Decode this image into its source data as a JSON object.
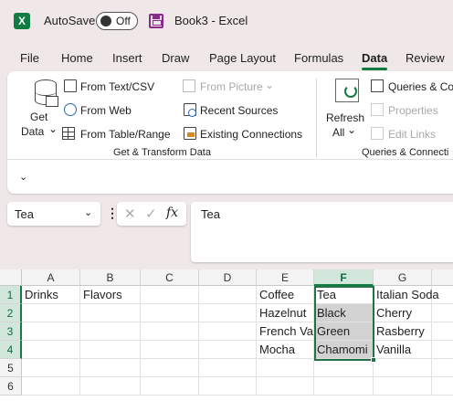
{
  "titlebar": {
    "app_icon": "X",
    "autosave_label": "AutoSave",
    "autosave_state": "Off",
    "doc_title": "Book3  -  Excel"
  },
  "tabs": [
    "File",
    "Home",
    "Insert",
    "Draw",
    "Page Layout",
    "Formulas",
    "Data",
    "Review"
  ],
  "active_tab": "Data",
  "ribbon": {
    "get_data": {
      "line1": "Get",
      "line2": "Data",
      "chev": "⌄"
    },
    "from_text_csv": "From Text/CSV",
    "from_web": "From Web",
    "from_table_range": "From Table/Range",
    "from_picture": "From Picture",
    "from_picture_chev": "⌄",
    "recent_sources": "Recent Sources",
    "existing_connections": "Existing Connections",
    "group_get_transform": "Get & Transform Data",
    "refresh_all": {
      "line1": "Refresh",
      "line2": "All",
      "chev": "⌄"
    },
    "queries_connections": "Queries & Co",
    "properties": "Properties",
    "edit_links": "Edit Links",
    "group_queries": "Queries & Connecti",
    "expand_glyph": "⌄"
  },
  "formula": {
    "name_box": "Tea",
    "name_box_chev": "⌄",
    "dots": "⋮",
    "cancel_glyph": "✕",
    "enter_glyph": "✓",
    "fx_label": "fx",
    "value": "Tea"
  },
  "sheet": {
    "columns": [
      "A",
      "B",
      "C",
      "D",
      "E",
      "F",
      "G"
    ],
    "rows": [
      "1",
      "2",
      "3",
      "4",
      "5",
      "6"
    ],
    "cells": {
      "A1": "Drinks",
      "B1": "Flavors",
      "E1": "Coffee",
      "E2": "Hazelnut",
      "E3": "French Va",
      "E4": "Mocha",
      "F1": "Tea",
      "F2": "Black",
      "F3": "Green",
      "F4": "Chamomi",
      "G1": "Italian Soda",
      "G2": "Cherry",
      "G3": "Rasberry",
      "G4": "Vanilla"
    },
    "selected_column": "F",
    "selected_range": "F1:F4"
  }
}
